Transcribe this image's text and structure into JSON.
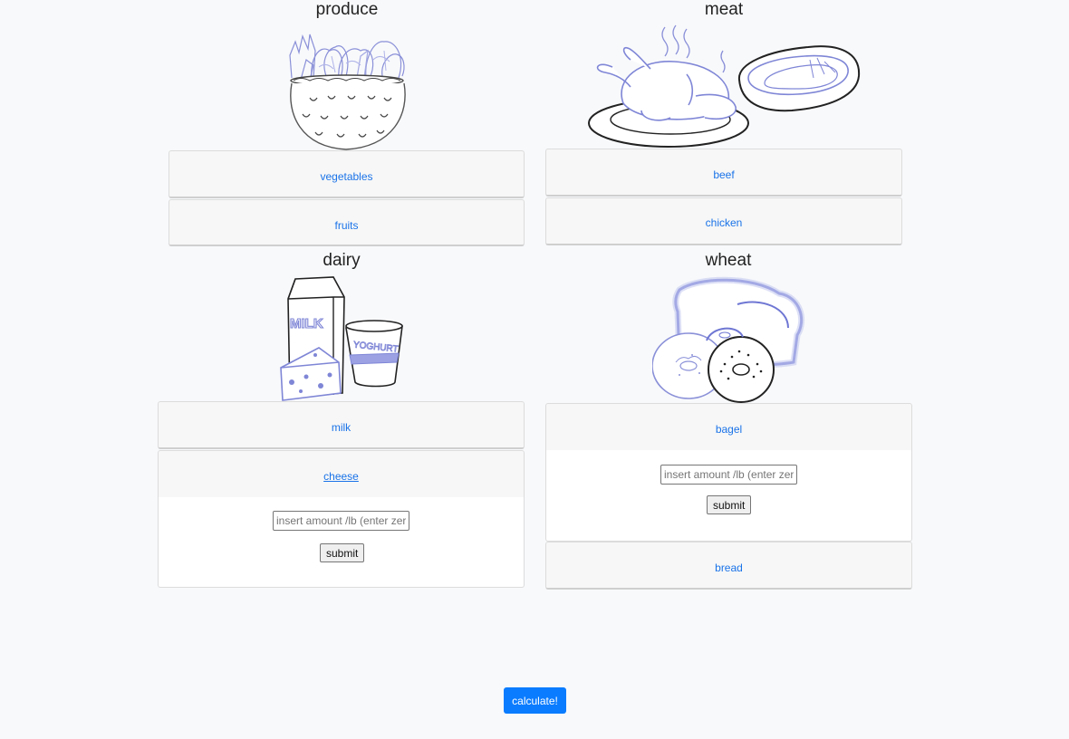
{
  "categories": {
    "produce": {
      "title": "produce",
      "items": [
        {
          "label": "vegetables"
        },
        {
          "label": "fruits"
        }
      ]
    },
    "meat": {
      "title": "meat",
      "items": [
        {
          "label": "beef"
        },
        {
          "label": "chicken"
        }
      ]
    },
    "dairy": {
      "title": "dairy",
      "items": [
        {
          "label": "milk"
        },
        {
          "label": "cheese"
        }
      ],
      "form": {
        "placeholder": "insert amount /lb (enter zero if none)",
        "submit_label": "submit"
      },
      "illustration_text": {
        "carton": "MILK",
        "cup": "YOGHURT"
      }
    },
    "wheat": {
      "title": "wheat",
      "items": [
        {
          "label": "bagel"
        },
        {
          "label": "bread"
        }
      ],
      "form": {
        "placeholder": "insert amount /lb (enter zero if none)",
        "submit_label": "submit"
      }
    }
  },
  "calculate_label": "calculate!",
  "colors": {
    "accent": "#0a7cff",
    "link": "#1a73e8",
    "illustration_blue": "#7f86d6"
  }
}
